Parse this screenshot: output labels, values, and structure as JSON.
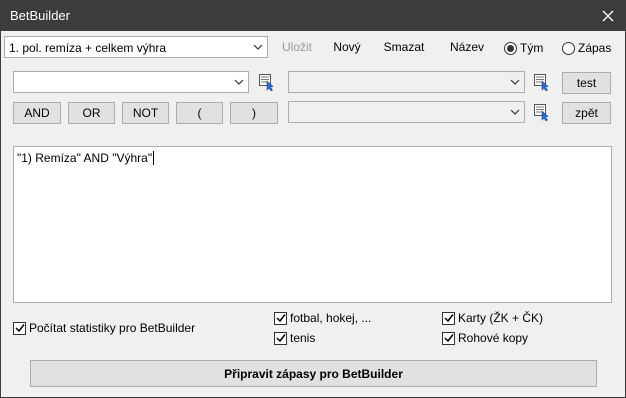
{
  "window": {
    "title": "BetBuilder"
  },
  "toolbar": {
    "preset_value": "1. pol. remíza + celkem výhra",
    "save_label": "Uložit",
    "new_label": "Nový",
    "delete_label": "Smazat",
    "name_label": "Název",
    "radio_team_label": "Tým",
    "radio_match_label": "Zápas",
    "radio_selected": "team"
  },
  "builder": {
    "left_combo_value": "",
    "right_combo_top_value": "",
    "right_combo_bottom_value": "",
    "operators": [
      "AND",
      "OR",
      "NOT",
      "(",
      ")"
    ],
    "test_label": "test",
    "back_label": "zpět"
  },
  "expression": {
    "text": "\"1) Remíza\" AND \"Výhra\""
  },
  "options": {
    "count_stats_label": "Počítat statistiky pro BetBuilder",
    "football_label": "fotbal, hokej, ...",
    "tennis_label": "tenis",
    "cards_label": "Karty (ŽK + ČK)",
    "corners_label": "Rohové kopy"
  },
  "footer": {
    "prepare_label": "Připravit zápasy pro BetBuilder"
  },
  "icons": {
    "close": "close-icon",
    "dropdown": "chevron-down-icon",
    "picker": "cursor-select-icon",
    "checkmark": "checkmark-icon"
  }
}
